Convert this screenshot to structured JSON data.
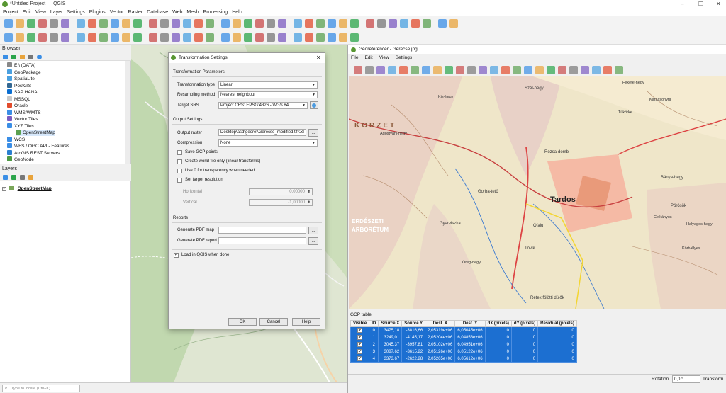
{
  "window": {
    "title": "*Untitled Project — QGIS"
  },
  "menu": [
    "Project",
    "Edit",
    "View",
    "Layer",
    "Settings",
    "Plugins",
    "Vector",
    "Raster",
    "Database",
    "Web",
    "Mesh",
    "Processing",
    "Help"
  ],
  "browser": {
    "title": "Browser",
    "items": [
      "E:\\ (DATA)",
      "GeoPackage",
      "SpatiaLite",
      "PostGIS",
      "SAP HANA",
      "MSSQL",
      "Oracle",
      "WMS/WMTS",
      "Vector Tiles",
      "XYZ Tiles",
      "OpenStreetMap",
      "WCS",
      "WFS / OGC API - Features",
      "ArcGIS REST Servers",
      "GeoNode"
    ]
  },
  "layers": {
    "title": "Layers",
    "items": [
      "OpenStreetMap"
    ]
  },
  "locator": {
    "placeholder": "Type to locate (Ctrl+K)"
  },
  "dialog": {
    "title": "Transformation Settings",
    "section_params": "Transformation Parameters",
    "type_label": "Transformation type",
    "type_value": "Linear",
    "resampling_label": "Resampling method",
    "resampling_value": "Nearest neighbour",
    "srs_label": "Target SRS",
    "srs_value": "Project CRS: EPSG:4326 - WGS 84",
    "section_output": "Output Settings",
    "raster_label": "Output raster",
    "raster_value": "Desktop\\asd\\georef\\Gerecse_modified.tif",
    "compression_label": "Compression",
    "compression_value": "None",
    "save_gcp": "Save GCP points",
    "world_file": "Create world file only (linear transforms)",
    "use_zero": "Use 0 for transparency when needed",
    "set_res": "Set target resolution",
    "horizontal_label": "Horizontal",
    "horizontal_value": "0,00000",
    "vertical_label": "Vertical",
    "vertical_value": "-1,00000",
    "section_reports": "Reports",
    "pdf_map": "Generate PDF map",
    "pdf_report": "Generate PDF report",
    "load_qgis": "Load in QGIS when done",
    "ok": "OK",
    "cancel": "Cancel",
    "help": "Help",
    "browse": "...",
    "clear": "⌫"
  },
  "georef": {
    "title": "Georeferencer - Gerecse.jpg",
    "menu": [
      "File",
      "Edit",
      "View",
      "Settings"
    ],
    "gcp_title": "GCP table",
    "headers": [
      "Visible",
      "ID",
      "Source X",
      "Source Y",
      "Dest. X",
      "Dest. Y",
      "dX (pixels)",
      "dY (pixels)",
      "Residual (pixels)"
    ],
    "rows": [
      [
        "✔",
        "0",
        "3475,18",
        "-3816,66",
        "2,05319e+06",
        "6,05045e+06",
        "0",
        "0",
        "0"
      ],
      [
        "✔",
        "1",
        "3249,01",
        "-4145,17",
        "2,05204e+06",
        "6,04858e+06",
        "0",
        "0",
        "0"
      ],
      [
        "✔",
        "2",
        "3045,37",
        "-3957,81",
        "2,05102e+06",
        "6,04951e+06",
        "0",
        "0",
        "0"
      ],
      [
        "✔",
        "3",
        "3087,62",
        "-3615,22",
        "2,05126e+06",
        "6,05122e+06",
        "0",
        "0",
        "0"
      ],
      [
        "✔",
        "4",
        "3373,67",
        "-2622,28",
        "2,05265e+06",
        "6,05612e+06",
        "0",
        "0",
        "0"
      ]
    ],
    "rotation_label": "Rotation",
    "rotation_value": "0,0 °",
    "transform_label": "Transform",
    "map_labels": [
      "KORZET",
      "Tardos",
      "Gyarviszka",
      "Szél-hegy",
      "Bánya-hegy",
      "Pörösök",
      "Rózsa-domb",
      "Gorba-tető",
      "Ófalu",
      "Tövik",
      "ERDÉSZETI",
      "ARBORÉTUM",
      "Rétek fölötti dülők",
      "Agostyáni-hegy",
      "Kis-hegy",
      "Tükörke",
      "Fekete-hegy",
      "Celkányos",
      "Körtvélyes",
      "Halyagos-hegy",
      "Öreg-hegy",
      "Karácsonyfa"
    ]
  },
  "colors": {
    "accent": "#1c6fd1",
    "qgis_green": "#589632"
  }
}
